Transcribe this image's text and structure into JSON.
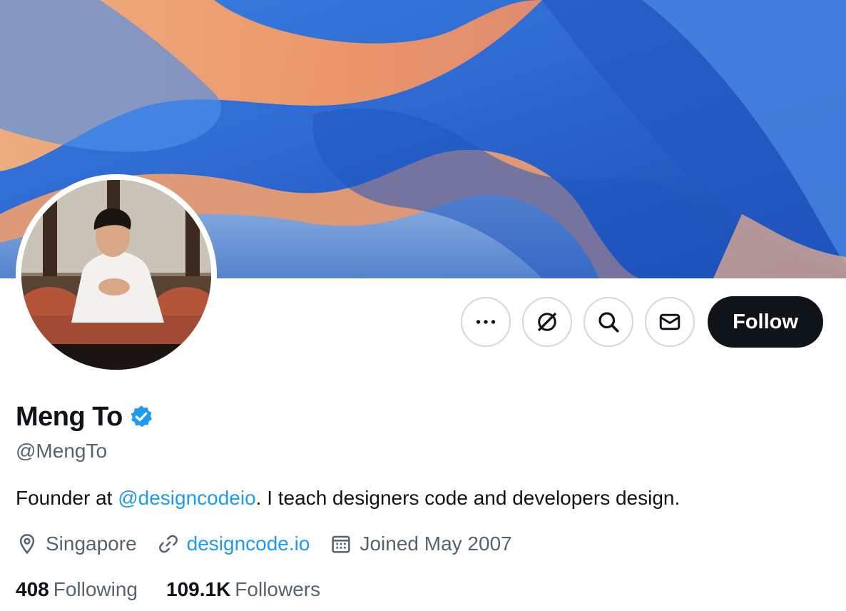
{
  "banner": {
    "colors": {
      "blue": "#2f6fd6",
      "orange": "#f4a46a",
      "deep": "#1c4fb3"
    }
  },
  "actions": {
    "more_icon": "more-horizontal-icon",
    "grok_icon": "grok-icon",
    "search_icon": "search-icon",
    "message_icon": "envelope-icon",
    "follow_label": "Follow"
  },
  "profile": {
    "display_name": "Meng To",
    "verified_icon": "verified-badge-icon",
    "handle": "@MengTo",
    "bio": {
      "prefix": "Founder at ",
      "mention": "@designcodeio",
      "suffix": ". I teach designers code and developers design."
    },
    "location": {
      "icon": "location-pin-icon",
      "text": "Singapore"
    },
    "website": {
      "icon": "link-icon",
      "text": "designcode.io"
    },
    "joined": {
      "icon": "calendar-icon",
      "text": "Joined May 2007"
    },
    "following": {
      "count": "408",
      "label": "Following"
    },
    "followers": {
      "count": "109.1K",
      "label": "Followers"
    }
  },
  "colors": {
    "accent": "#1d9bf0",
    "text": "#0f1419",
    "muted": "#536471",
    "border": "#cfd9de"
  }
}
